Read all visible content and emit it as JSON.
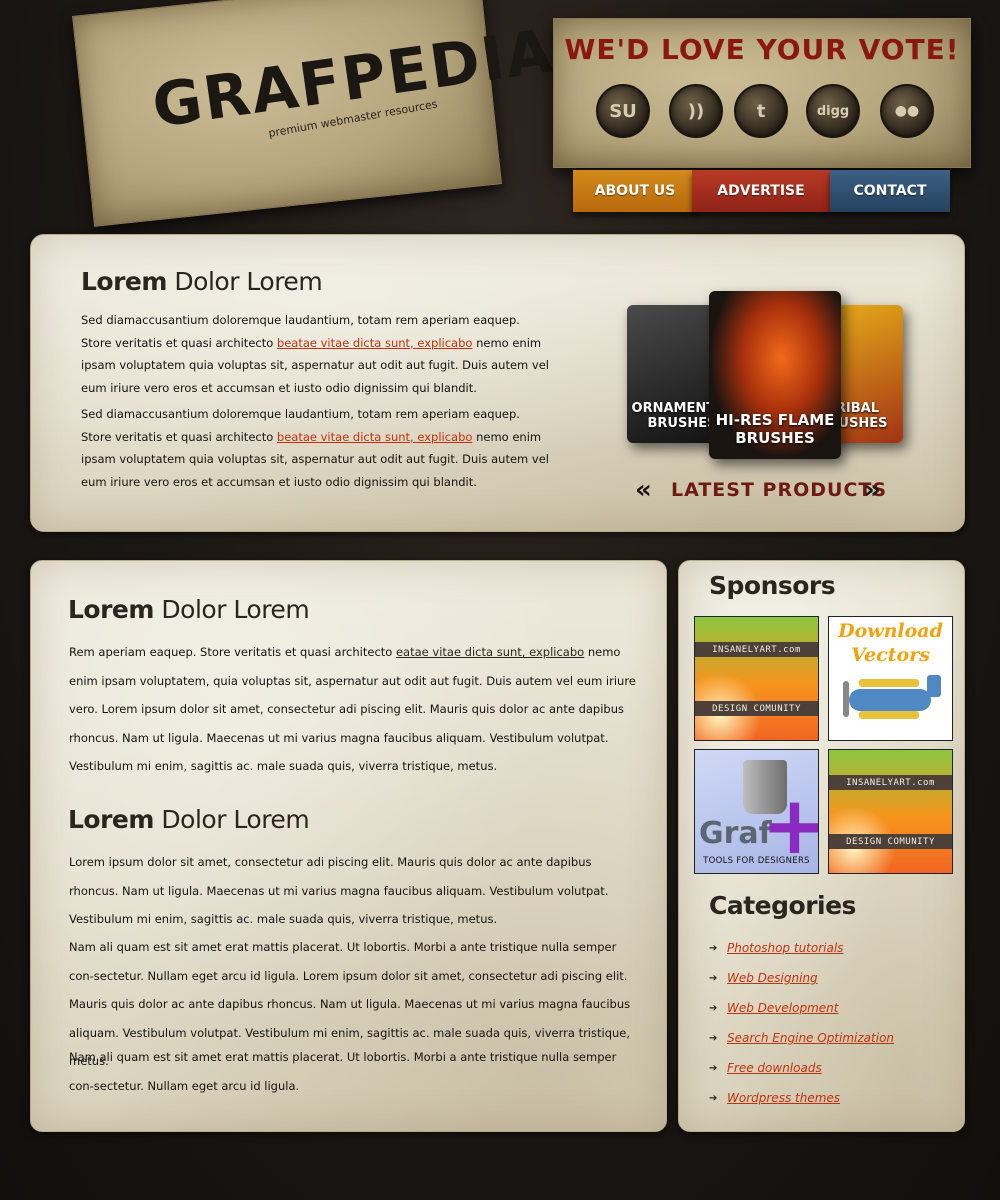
{
  "header": {
    "logo_title": "GRAFPEDIA",
    "logo_tagline": "premium webmaster resources",
    "vote_title": "We'd love your vote!",
    "social": [
      {
        "name": "stumbleupon",
        "glyph": "SU"
      },
      {
        "name": "rss",
        "glyph": "))"
      },
      {
        "name": "twitter",
        "glyph": "t"
      },
      {
        "name": "digg",
        "glyph": "digg"
      },
      {
        "name": "flickr",
        "glyph": "●●"
      }
    ],
    "nav": [
      {
        "label": "ABOUT US",
        "color": "#c77a13"
      },
      {
        "label": "ADVERTISE",
        "color": "#a72e1f"
      },
      {
        "label": "CONTACT",
        "color": "#2f5373"
      }
    ]
  },
  "featured": {
    "heading_bold": "Lorem",
    "heading_light": "Dolor Lorem",
    "paragraphs": [
      {
        "before": "Sed diamaccusantium doloremque laudantium, totam rem aperiam eaquep. Store veritatis et quasi architecto ",
        "link": "beatae vitae dicta sunt, explicabo",
        "after": " nemo enim ipsam voluptatem quia voluptas sit, aspernatur aut odit aut fugit. Duis autem vel eum iriure vero eros et accumsan et iusto odio dignissim qui blandit."
      },
      {
        "before": "Sed diamaccusantium doloremque laudantium, totam rem aperiam eaquep. Store veritatis et quasi architecto ",
        "link": "beatae vitae dicta sunt, explicabo",
        "after": " nemo enim ipsam voluptatem quia voluptas sit, aspernatur aut odit aut fugit. Duis autem vel eum iriure vero eros et accumsan et iusto odio dignissim qui blandit."
      }
    ],
    "products": {
      "ornamental": "ORNAMENTAL BRUSHES",
      "flames": "HI-RES FLAME BRUSHES",
      "tribal": "TRIBAL BRUSHES",
      "latest_label": "LATEST PRODUCTS",
      "prev_glyph": "«",
      "next_glyph": "»"
    }
  },
  "main": {
    "section1": {
      "heading_bold": "Lorem",
      "heading_light": "Dolor Lorem",
      "p1_before": "Rem aperiam eaquep. Store veritatis et quasi architecto ",
      "p1_link": "eatae vitae dicta sunt, explicabo",
      "p1_after": " nemo enim ipsam voluptatem, quia voluptas sit, aspernatur aut odit aut fugit. Duis autem vel eum iriure vero. Lorem ipsum dolor sit amet, consectetur adi piscing elit. Mauris quis dolor ac ante dapibus rhoncus. Nam ut ligula. Maecenas ut mi varius magna faucibus aliquam. Vestibulum volutpat. Vestibulum mi enim, sagittis ac. male suada quis, viverra tristique, metus."
    },
    "section2": {
      "heading_bold": "Lorem",
      "heading_light": "Dolor Lorem",
      "p2": "Lorem ipsum dolor sit amet, consectetur adi piscing elit. Mauris quis dolor ac ante dapibus rhoncus. Nam ut ligula. Maecenas ut mi varius magna faucibus aliquam. Vestibulum volutpat. Vestibulum mi enim, sagittis ac. male suada quis, viverra tristique, metus.",
      "p3": "Nam ali quam est sit amet erat mattis placerat. Ut lobortis. Morbi a ante tristique nulla semper con-sectetur. Nullam eget arcu id ligula. Lorem ipsum dolor sit amet, consectetur adi piscing elit. Mauris quis dolor ac ante dapibus rhoncus. Nam ut ligula. Maecenas ut mi varius magna faucibus aliquam. Vestibulum volutpat. Vestibulum mi enim, sagittis ac. male suada quis, viverra tristique, metus.",
      "p4": "Nam ali quam est sit amet erat mattis placerat. Ut lobortis. Morbi a ante tristique nulla semper con-sectetur. Nullam eget arcu id ligula."
    }
  },
  "sidebar": {
    "sponsors_heading": "Sponsors",
    "ads": {
      "insanely_top": "INSANELYART.com",
      "insanely_bottom": "DESIGN COMUNITY",
      "vectors_title": "Download Vectors",
      "graf_word": "Graf",
      "graf_plus": "+",
      "graf_sub": "TOOLS FOR DESIGNERS"
    },
    "categories_heading": "Categories",
    "categories": [
      "Photoshop tutorials",
      "Web Designing",
      "Web Development",
      "Search Engine Optimization",
      "Free downloads",
      "Wordpress themes"
    ]
  },
  "colors": {
    "link": "#c3320e",
    "background": "#1e1915",
    "paper": "#e8e4d5",
    "accent_red": "#8a1712"
  }
}
